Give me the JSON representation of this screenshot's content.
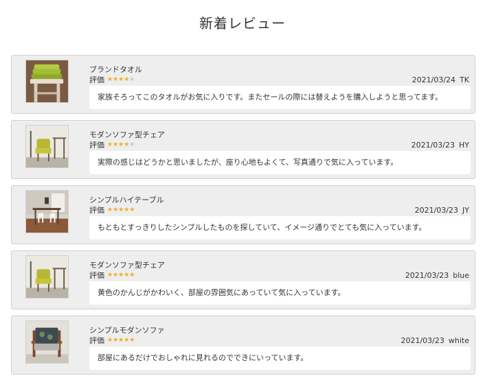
{
  "page": {
    "title": "新着レビュー"
  },
  "rating_label": "評価",
  "colors": {
    "star_filled": "#f2b01e",
    "star_empty": "#c9c9c9",
    "card_bg": "#eeeeee",
    "comment_bg": "#ffffff"
  },
  "reviews": [
    {
      "product": "ブランドタオル",
      "rating": 4,
      "date": "2021/03/24",
      "author": "TK",
      "comment": "家族そろってこのタオルがお気に入りです。またセールの際には替えようを購入しようと思ってます。",
      "image": "towel-photo"
    },
    {
      "product": "モダンソファ型チェア",
      "rating": 4,
      "date": "2021/03/23",
      "author": "HY",
      "comment": "実際の感じはどうかと思いましたが、座り心地もよくて、写真通りで気に入っています。",
      "image": "yellow-chair-photo"
    },
    {
      "product": "シンプルハイテーブル",
      "rating": 5,
      "date": "2021/03/23",
      "author": "JY",
      "comment": "もともとすっきりしたシンプルしたものを探していて、イメージ通りでとても気に入っています。",
      "image": "dining-table-photo"
    },
    {
      "product": "モダンソファ型チェア",
      "rating": 5,
      "date": "2021/03/23",
      "author": "blue",
      "comment": "黄色のかんじがかわいく、部屋の雰囲気にあっていて気に入っています。",
      "image": "yellow-chair-photo"
    },
    {
      "product": "シンプルモダンソファ",
      "rating": 5,
      "date": "2021/03/23",
      "author": "white",
      "comment": "部屋にあるだけでおしゃれに見れるのでできにいっています。",
      "image": "armchair-photo"
    }
  ]
}
